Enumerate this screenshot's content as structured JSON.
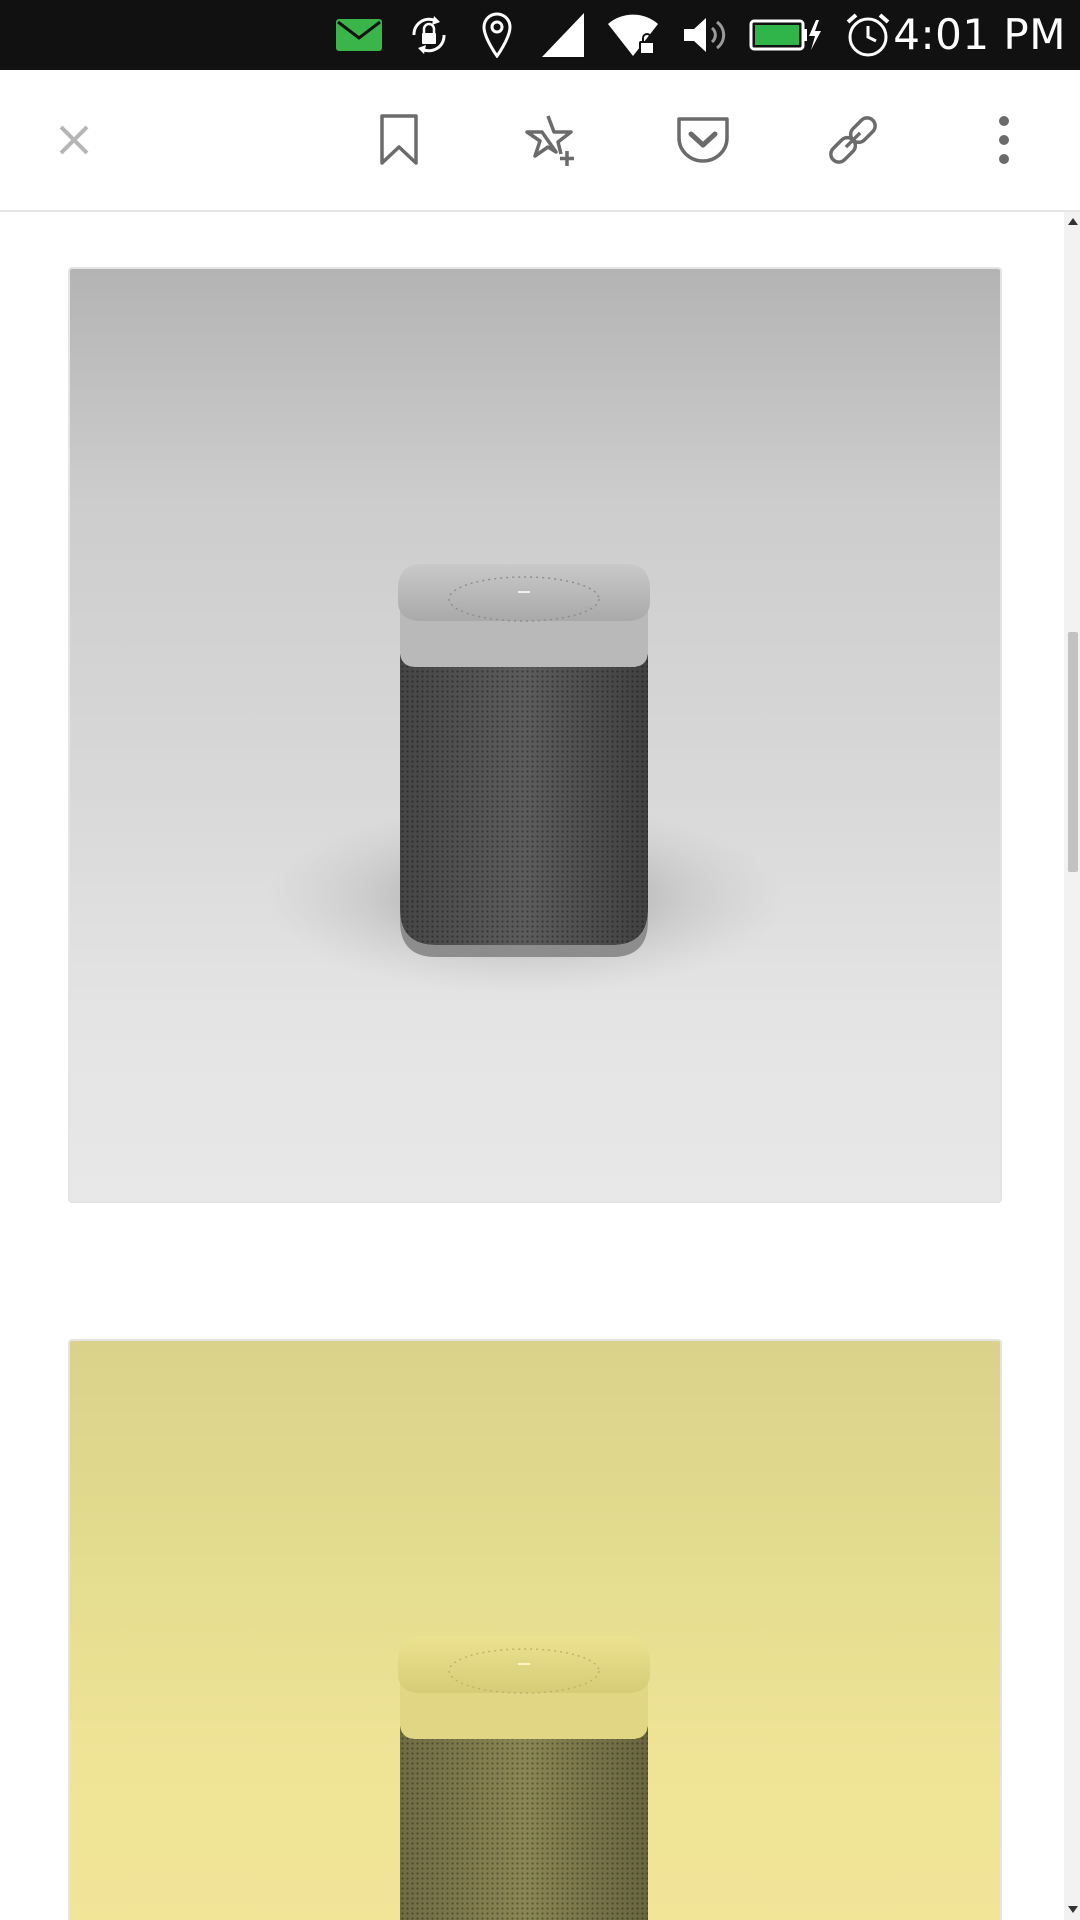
{
  "status_bar": {
    "time": "4:01 PM",
    "icons": [
      "mail-icon",
      "screen-rotation-lock-icon",
      "location-icon",
      "signal-icon",
      "wifi-icon",
      "volume-icon",
      "battery-charging-icon",
      "alarm-icon"
    ],
    "mail_color": "#39b54a",
    "battery_color": "#2fb54a"
  },
  "toolbar": {
    "buttons": [
      "close-icon",
      "bookmark-icon",
      "add-favorite-icon",
      "pocket-icon",
      "link-icon",
      "more-options-icon"
    ]
  },
  "content": {
    "images": [
      {
        "subject": "gray-speaker",
        "background": "#d4d4d4"
      },
      {
        "subject": "yellow-speaker",
        "background": "#e8df92"
      }
    ]
  }
}
